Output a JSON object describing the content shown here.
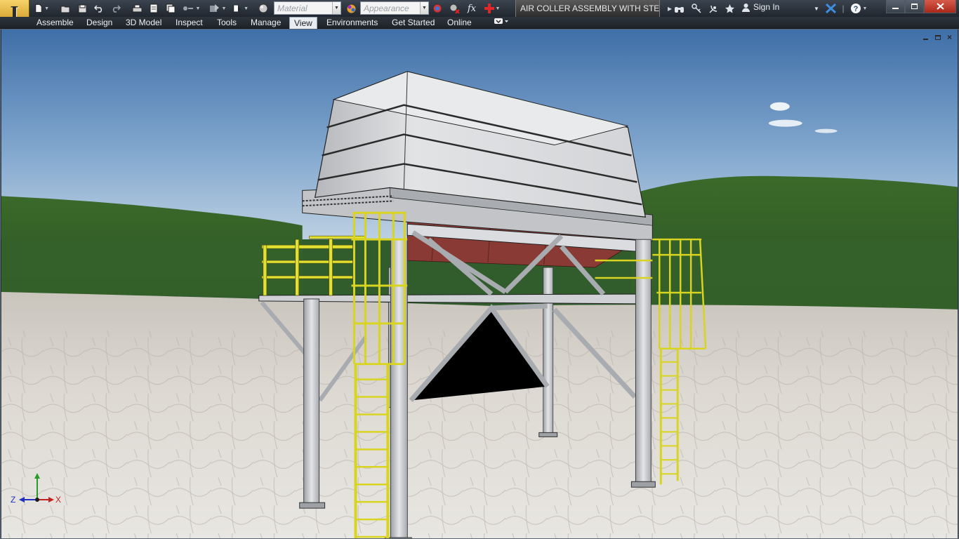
{
  "app": {
    "logo_glyph": "I",
    "logo_icon": "inventor-app-icon"
  },
  "quick_access": {
    "material_placeholder": "Material",
    "appearance_placeholder": "Appearance",
    "fx_label": "fx"
  },
  "document": {
    "title": "AIR COLLER ASSEMBLY WITH STEEL ..."
  },
  "account": {
    "sign_in_label": "Sign In"
  },
  "ribbon": {
    "tabs": [
      {
        "label": "Assemble"
      },
      {
        "label": "Design"
      },
      {
        "label": "3D Model"
      },
      {
        "label": "Inspect"
      },
      {
        "label": "Tools"
      },
      {
        "label": "Manage"
      },
      {
        "label": "View",
        "active": true
      },
      {
        "label": "Environments"
      },
      {
        "label": "Get Started"
      },
      {
        "label": "Online"
      }
    ]
  },
  "triad": {
    "z_label": "Z",
    "x_label": "X"
  },
  "colors": {
    "titlebar": "#2a3038",
    "sky_top": "#4f7fb4",
    "steel": "#c9ccd0",
    "railing": "#e2e030",
    "heat_exchanger": "#8a3a34"
  }
}
